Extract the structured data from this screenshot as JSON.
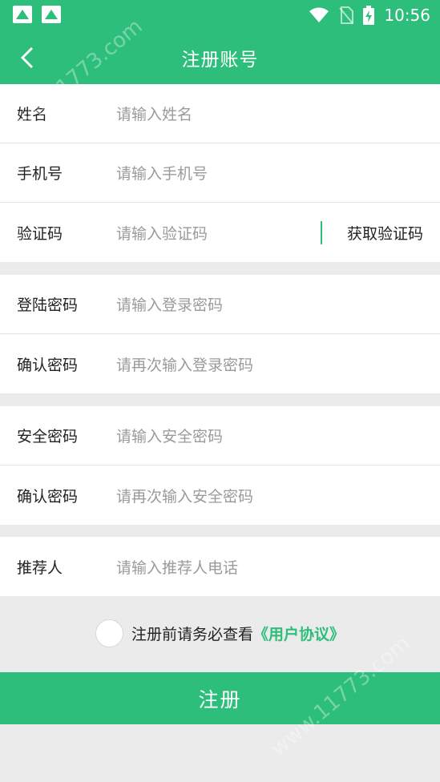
{
  "status_bar": {
    "time": "10:56"
  },
  "header": {
    "title": "注册账号"
  },
  "form": {
    "name": {
      "label": "姓名",
      "placeholder": "请输入姓名"
    },
    "phone": {
      "label": "手机号",
      "placeholder": "请输入手机号"
    },
    "code": {
      "label": "验证码",
      "placeholder": "请输入验证码",
      "button": "获取验证码"
    },
    "login_password": {
      "label": "登陆密码",
      "placeholder": "请输入登录密码"
    },
    "confirm_login_password": {
      "label": "确认密码",
      "placeholder": "请再次输入登录密码"
    },
    "safe_password": {
      "label": "安全密码",
      "placeholder": "请输入安全密码"
    },
    "confirm_safe_password": {
      "label": "确认密码",
      "placeholder": "请再次输入安全密码"
    },
    "referrer": {
      "label": "推荐人",
      "placeholder": "请输入推荐人电话"
    }
  },
  "agreement": {
    "text": "注册前请务必查看",
    "link": "《用户协议》"
  },
  "submit": {
    "label": "注册"
  },
  "watermark": {
    "text": "www.11773.com"
  },
  "colors": {
    "accent": "#2dbe7b",
    "background": "#ebebeb"
  }
}
